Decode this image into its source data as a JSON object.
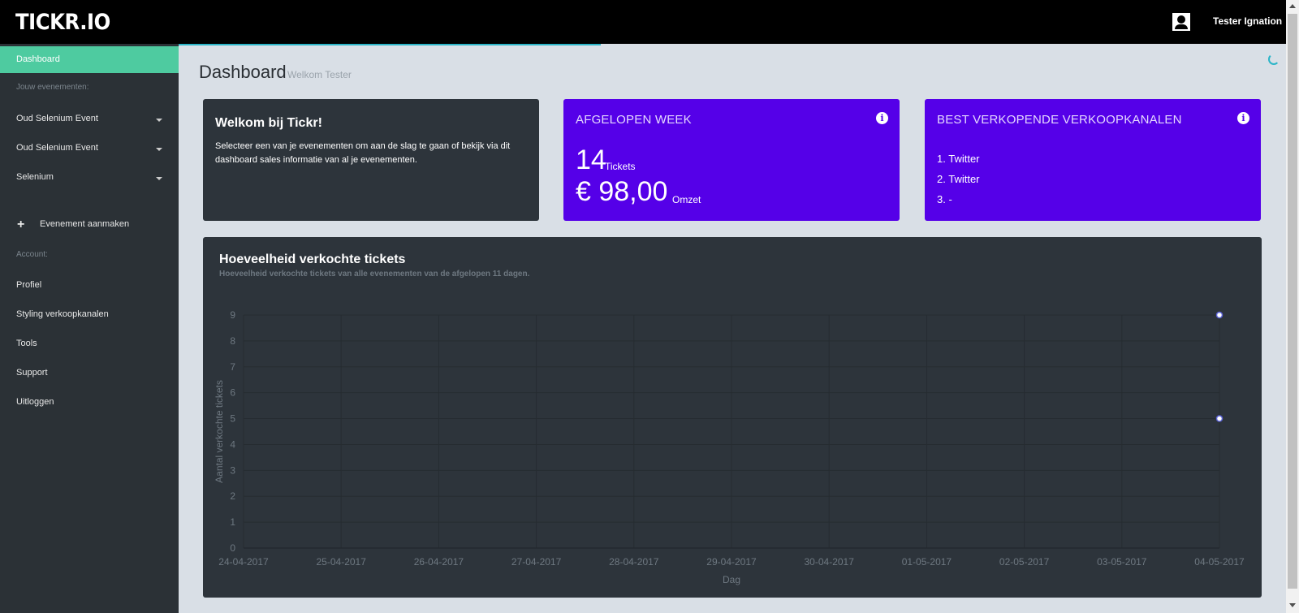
{
  "topbar": {
    "logo": "TICKR.IO",
    "username": "Tester Ignation"
  },
  "sidebar": {
    "active": "Dashboard",
    "events_label": "Jouw evenementen:",
    "events": [
      "Oud Selenium Event",
      "Oud Selenium Event",
      "Selenium"
    ],
    "create": "Evenement aanmaken",
    "account_label": "Account:",
    "account_items": [
      "Profiel",
      "Styling verkoopkanalen",
      "Tools",
      "Support",
      "Uitloggen"
    ]
  },
  "page": {
    "title": "Dashboard",
    "subtitle": "Welkom Tester"
  },
  "welcome": {
    "title": "Welkom bij Tickr!",
    "text": "Selecteer een van je evenementen om aan de slag te gaan of bekijk via dit dashboard sales informatie van al je evenementen."
  },
  "week": {
    "title": "AFGELOPEN WEEK",
    "tickets": "14",
    "tickets_label": "Tickets",
    "revenue": "€ 98,00",
    "revenue_label": "Omzet"
  },
  "channels": {
    "title": "BEST VERKOPENDE VERKOOPKANALEN",
    "items": [
      "1. Twitter",
      "2. Twitter",
      "3. -"
    ]
  },
  "colors": {
    "accent": "#4ecba0",
    "purple": "#5500e8",
    "card_dark": "#2d343b",
    "progress": "#2bb5c8"
  },
  "icons": {
    "user": "user-icon",
    "info": "info-icon",
    "plus": "plus-icon",
    "caret": "chevron-down-icon"
  },
  "chart_data": {
    "type": "scatter",
    "title": "Hoeveelheid verkochte tickets",
    "subtitle": "Hoeveelheid verkochte tickets van alle evenementen van de afgelopen 11 dagen.",
    "xlabel": "Dag",
    "ylabel": "Aantal verkochte tickets",
    "categories": [
      "24-04-2017",
      "25-04-2017",
      "26-04-2017",
      "27-04-2017",
      "28-04-2017",
      "29-04-2017",
      "30-04-2017",
      "01-05-2017",
      "02-05-2017",
      "03-05-2017",
      "04-05-2017"
    ],
    "yticks": [
      0,
      1,
      2,
      3,
      4,
      5,
      6,
      7,
      8,
      9
    ],
    "ylim": [
      0,
      9
    ],
    "grid": true,
    "points": [
      {
        "x": "04-05-2017",
        "y": 9
      },
      {
        "x": "04-05-2017",
        "y": 5
      }
    ]
  }
}
